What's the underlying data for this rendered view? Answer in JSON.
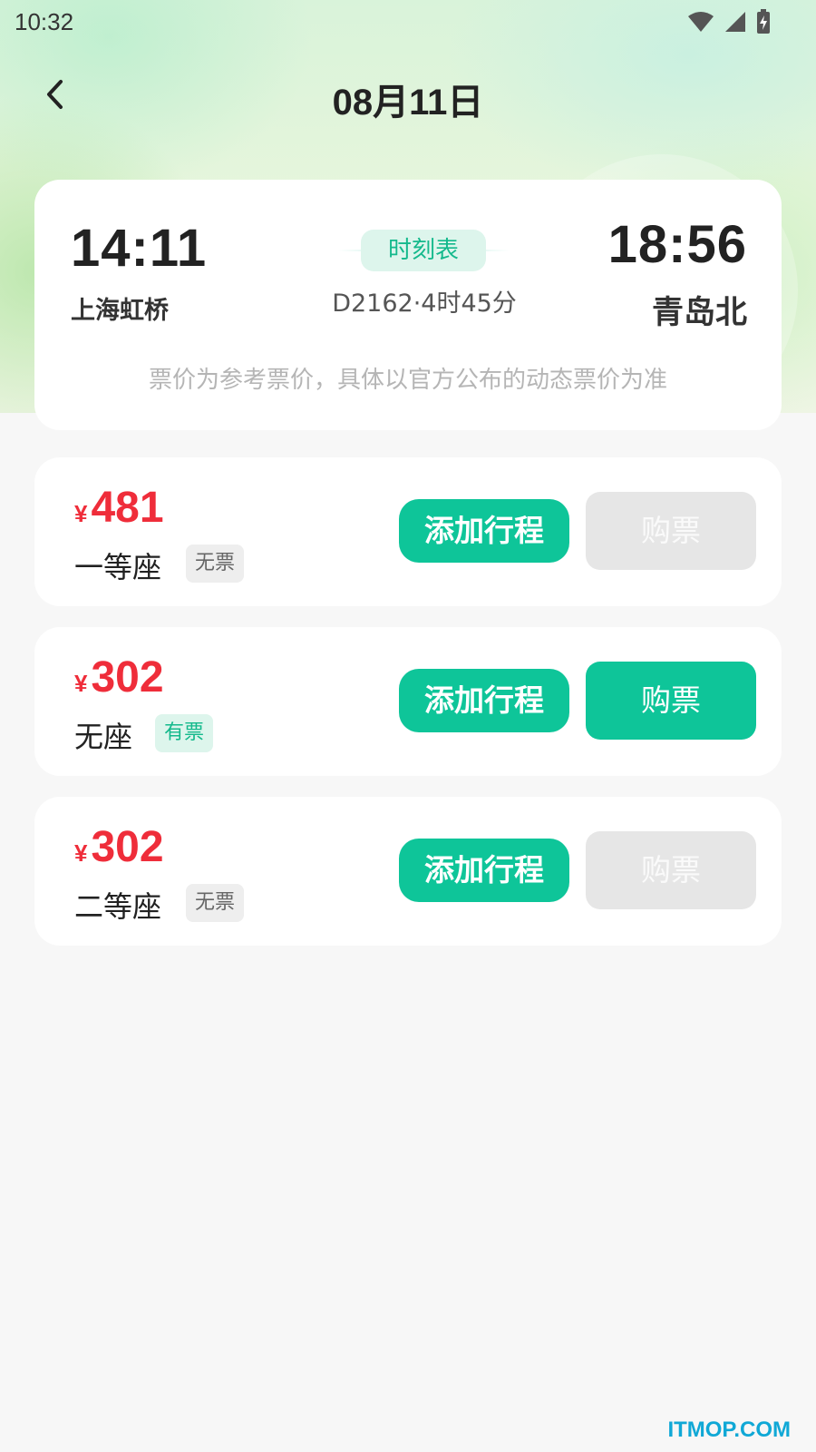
{
  "status_bar": {
    "time": "10:32"
  },
  "header": {
    "title": "08月11日"
  },
  "trip": {
    "departure_time": "14:11",
    "departure_station": "上海虹桥",
    "arrival_time": "18:56",
    "arrival_station": "青岛北",
    "timetable_label": "时刻表",
    "train_info": "D2162·4时45分",
    "notice": "票价为参考票价，具体以官方公布的动态票价为准"
  },
  "seats": [
    {
      "currency": "¥",
      "price": "481",
      "name": "一等座",
      "availability": "无票",
      "available": false,
      "add_label": "添加行程",
      "buy_label": "购票"
    },
    {
      "currency": "¥",
      "price": "302",
      "name": "无座",
      "availability": "有票",
      "available": true,
      "add_label": "添加行程",
      "buy_label": "购票"
    },
    {
      "currency": "¥",
      "price": "302",
      "name": "二等座",
      "availability": "无票",
      "available": false,
      "add_label": "添加行程",
      "buy_label": "购票"
    }
  ],
  "watermark": "ITMOP.COM",
  "colors": {
    "accent": "#0ec599",
    "price": "#ef2d3a",
    "disabled": "#e6e6e6"
  }
}
